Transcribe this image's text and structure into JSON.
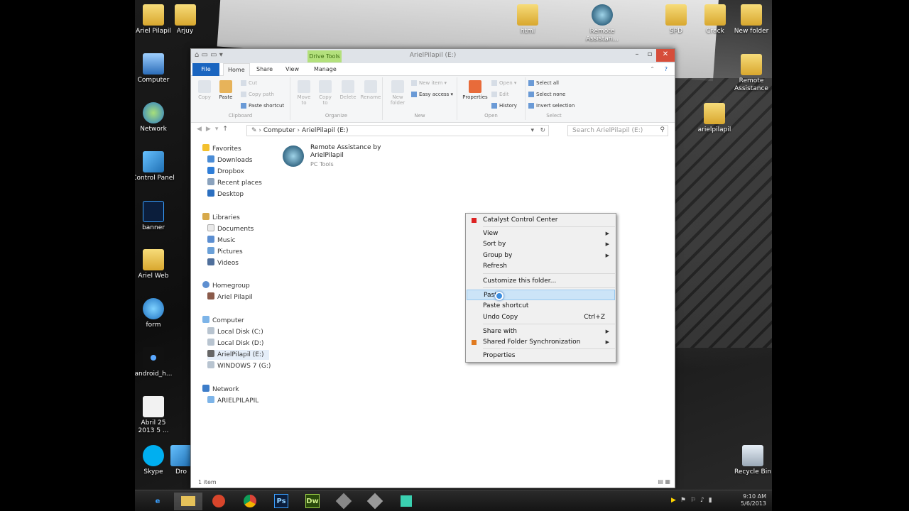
{
  "desktop": {
    "icons": [
      {
        "label": "Ariel Pilapil",
        "type": "folder"
      },
      {
        "label": "Arjuy",
        "type": "folder"
      },
      {
        "label": "Computer",
        "type": "pc"
      },
      {
        "label": "Network",
        "type": "net"
      },
      {
        "label": "Control Panel",
        "type": "cpanel"
      },
      {
        "label": "banner",
        "type": "ps"
      },
      {
        "label": "Ariel Web",
        "type": "folder"
      },
      {
        "label": "form",
        "type": "ie"
      },
      {
        "label": "android_h...",
        "type": "dark"
      },
      {
        "label": "Abril 25 2013 5 ...",
        "type": "doc"
      },
      {
        "label": "Skype",
        "type": "sky"
      },
      {
        "label": "Dro",
        "type": "cpanel"
      },
      {
        "label": "html",
        "type": "folder"
      },
      {
        "label": "Remote Assistan...",
        "type": "ra"
      },
      {
        "label": "SPD",
        "type": "folder"
      },
      {
        "label": "Crack",
        "type": "folder"
      },
      {
        "label": "New folder",
        "type": "folder"
      },
      {
        "label": "Remote Assistance",
        "type": "folder"
      },
      {
        "label": "arielpilapil",
        "type": "folder"
      },
      {
        "label": "Recycle Bin",
        "type": "bin"
      }
    ]
  },
  "window": {
    "title": "ArielPilapil (E:)",
    "contextual_tab": "Drive Tools",
    "tabs": {
      "file": "File",
      "home": "Home",
      "share": "Share",
      "view": "View",
      "manage": "Manage"
    },
    "ribbon": {
      "clipboard": {
        "name": "Clipboard",
        "copy": "Copy",
        "paste": "Paste",
        "cut": "Cut",
        "copy_path": "Copy path",
        "paste_shortcut": "Paste shortcut"
      },
      "organize": {
        "name": "Organize",
        "move_to": "Move to",
        "copy_to": "Copy to",
        "delete": "Delete",
        "rename": "Rename"
      },
      "new": {
        "name": "New",
        "new_folder": "New folder",
        "new_item": "New item",
        "easy_access": "Easy access"
      },
      "open": {
        "name": "Open",
        "properties": "Properties",
        "open": "Open",
        "edit": "Edit",
        "history": "History"
      },
      "select": {
        "name": "Select",
        "select_all": "Select all",
        "select_none": "Select none",
        "invert": "Invert selection"
      }
    },
    "address": {
      "crumb1": "Computer",
      "crumb2": "ArielPilapil (E:)",
      "search_placeholder": "Search ArielPilapil (E:)"
    },
    "nav": {
      "favorites": "Favorites",
      "downloads": "Downloads",
      "dropbox": "Dropbox",
      "recent": "Recent places",
      "desktop": "Desktop",
      "libraries": "Libraries",
      "documents": "Documents",
      "music": "Music",
      "pictures": "Pictures",
      "videos": "Videos",
      "homegroup": "Homegroup",
      "hg_user": "Ariel Pilapil",
      "computer": "Computer",
      "disk_c": "Local Disk (C:)",
      "disk_d": "Local Disk (D:)",
      "disk_e": "ArielPilapil (E:)",
      "disk_g": "WINDOWS 7 (G:)",
      "network": "Network",
      "net_pc": "ARIELPILAPIL"
    },
    "file": {
      "name1": "Remote Assistance by",
      "name2": "ArielPilapil",
      "company": "PC Tools"
    },
    "status": "1 item"
  },
  "context_menu": {
    "catalyst": "Catalyst Control Center",
    "view": "View",
    "sort_by": "Sort by",
    "group_by": "Group by",
    "refresh": "Refresh",
    "customize": "Customize this folder...",
    "paste": "Paste",
    "paste_shortcut": "Paste shortcut",
    "undo_copy": "Undo Copy",
    "undo_shortcut": "Ctrl+Z",
    "share_with": "Share with",
    "shared_sync": "Shared Folder Synchronization",
    "properties": "Properties"
  },
  "taskbar": {
    "time": "9:10 AM",
    "date": "5/6/2013",
    "ps_label": "Ps",
    "dw_label": "Dw"
  }
}
